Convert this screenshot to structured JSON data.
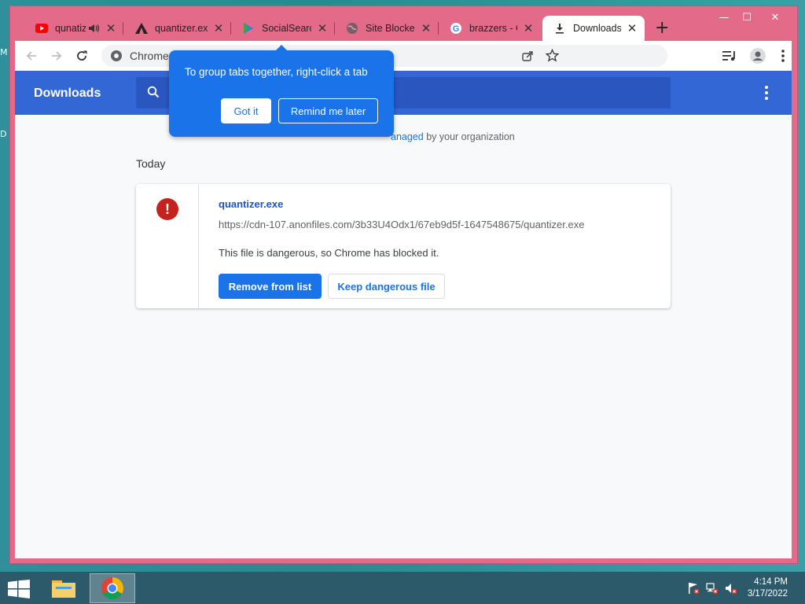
{
  "desktop": {
    "edge_text_1": "M",
    "edge_text_2": "D"
  },
  "window": {
    "tabs": [
      {
        "title": "qunatizer",
        "icon": "youtube-icon",
        "audio": true
      },
      {
        "title": "quantizer.exe",
        "icon": "site-icon"
      },
      {
        "title": "SocialSearch",
        "icon": "socialsearch-icon"
      },
      {
        "title": "Site Blocked",
        "icon": "globe-icon"
      },
      {
        "title": "brazzers - Go",
        "icon": "google-icon"
      },
      {
        "title": "Downloads",
        "icon": "download-icon",
        "active": true
      }
    ],
    "close_glyph": "✕",
    "new_tab_glyph": "+",
    "controls": {
      "minimize": "—",
      "maximize": "☐",
      "close": "✕"
    }
  },
  "toolbar": {
    "omnibox_text": "Chrome"
  },
  "page": {
    "header_title": "Downloads",
    "managed_prefix": "",
    "managed_link": "anaged",
    "managed_suffix": " by your organization",
    "section_label": "Today",
    "download": {
      "file_name": "quantizer.exe",
      "url": "https://cdn-107.anonfiles.com/3b33U4Odx1/67eb9d5f-1647548675/quantizer.exe",
      "warning": "This file is dangerous, so Chrome has blocked it.",
      "primary_button": "Remove from list",
      "secondary_button": "Keep dangerous file",
      "danger_glyph": "!"
    }
  },
  "bubble": {
    "text": "To group tabs together, right-click a tab",
    "got_it": "Got it",
    "remind": "Remind me later"
  },
  "taskbar": {
    "time": "4:14 PM",
    "date": "3/17/2022"
  },
  "colors": {
    "chrome_frame": "#e46a8a",
    "header_blue": "#3367d6",
    "accent": "#1a73e8",
    "danger": "#c5221f",
    "taskbar": "#2c5a6b"
  }
}
